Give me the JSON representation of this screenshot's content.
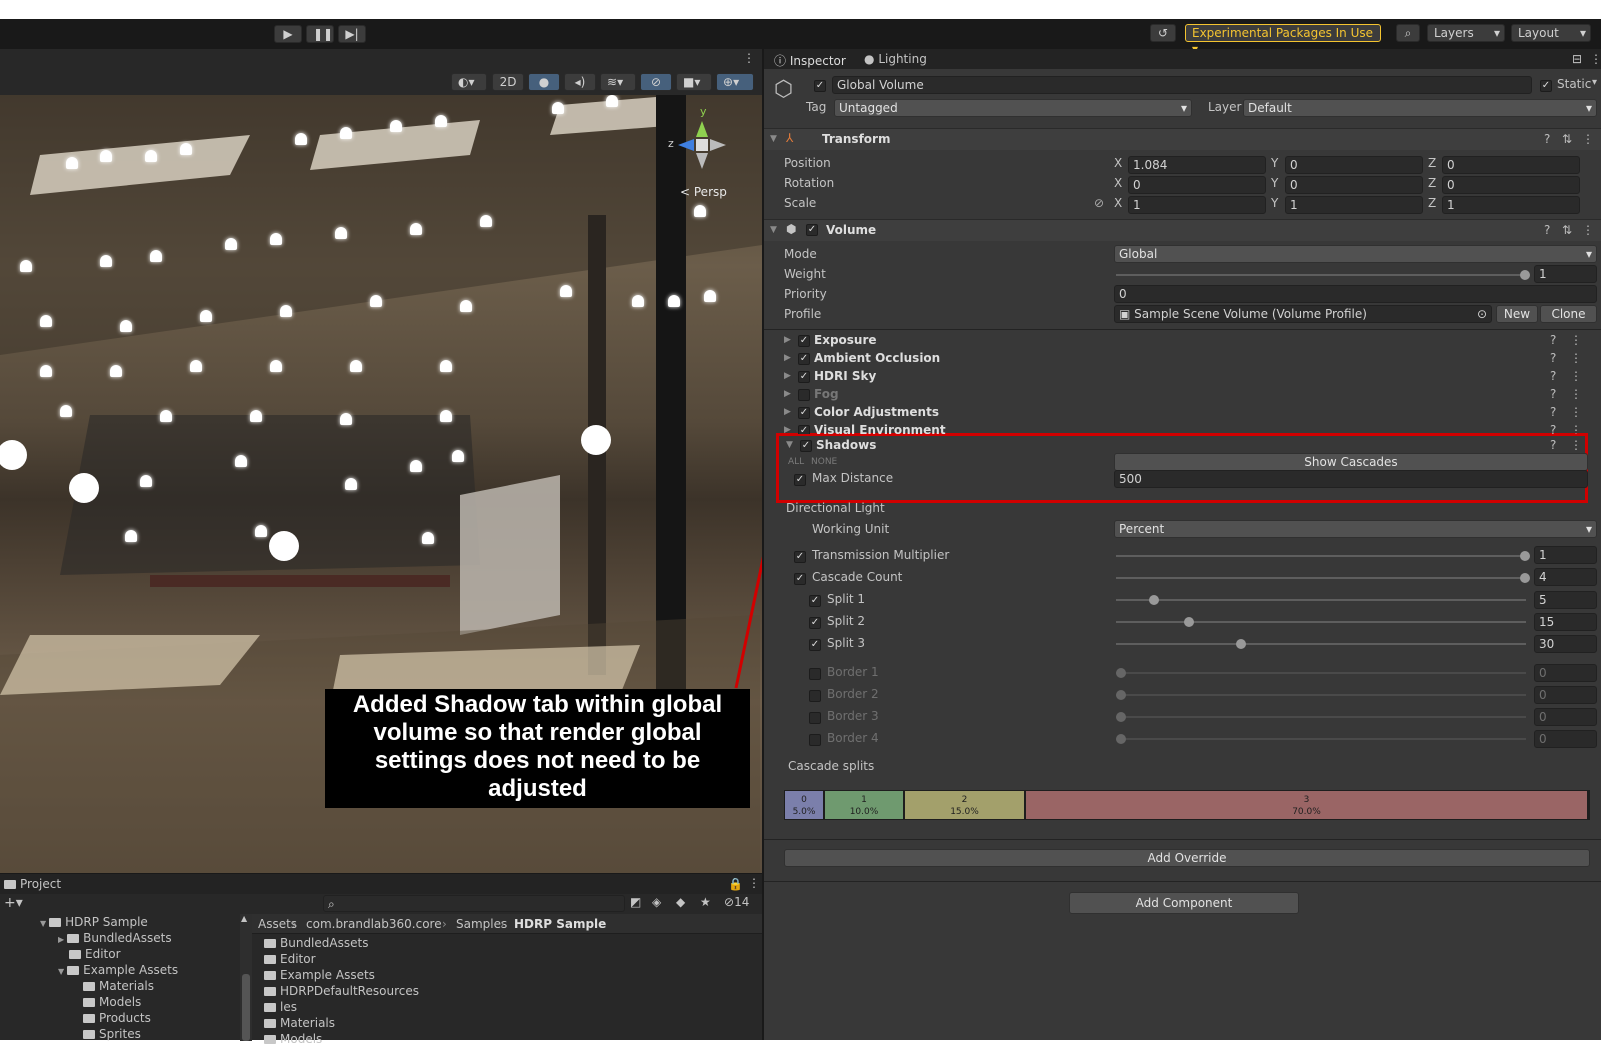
{
  "toolbar": {
    "experimental_label": "Experimental Packages In Use",
    "layers_label": "Layers",
    "layout_label": "Layout",
    "colors": {
      "experimental": "#f4c430"
    }
  },
  "scene": {
    "mode_2d": "2D",
    "persp_label": "Persp",
    "gizmo_y": "y",
    "gizmo_z": "z",
    "annotation": "Added Shadow tab within global volume so that render global settings does not need to be adjusted"
  },
  "project": {
    "tab_label": "Project",
    "hidden_count": "14",
    "tree": [
      {
        "label": "HDRP Sample",
        "depth": 0
      },
      {
        "label": "BundledAssets",
        "depth": 1
      },
      {
        "label": "Editor",
        "depth": 1
      },
      {
        "label": "Example Assets",
        "depth": 1
      },
      {
        "label": "Materials",
        "depth": 2
      },
      {
        "label": "Models",
        "depth": 2
      },
      {
        "label": "Products",
        "depth": 2
      },
      {
        "label": "Sprites",
        "depth": 2
      }
    ],
    "breadcrumb": [
      "Assets",
      "com.brandlab360.core",
      "Samples",
      "HDRP Sample"
    ],
    "files": [
      "BundledAssets",
      "Editor",
      "Example Assets",
      "HDRPDefaultResources",
      "les",
      "Materials",
      "Models"
    ]
  },
  "inspector": {
    "tab_inspector": "Inspector",
    "tab_lighting": "Lighting",
    "object_name": "Global Volume",
    "static_label": "Static",
    "tag_label": "Tag",
    "tag_value": "Untagged",
    "layer_label": "Layer",
    "layer_value": "Default",
    "transform": {
      "title": "Transform",
      "position_label": "Position",
      "position": [
        "1.084",
        "0",
        "0"
      ],
      "rotation_label": "Rotation",
      "rotation": [
        "0",
        "0",
        "0"
      ],
      "scale_label": "Scale",
      "scale": [
        "1",
        "1",
        "1"
      ],
      "axes": [
        "X",
        "Y",
        "Z"
      ]
    },
    "volume": {
      "title": "Volume",
      "mode_label": "Mode",
      "mode_value": "Global",
      "weight_label": "Weight",
      "weight_value": "1",
      "priority_label": "Priority",
      "priority_value": "0",
      "profile_label": "Profile",
      "profile_value": "Sample Scene Volume (Volume Profile)",
      "new_label": "New",
      "clone_label": "Clone"
    },
    "overrides": [
      {
        "label": "Exposure",
        "enabled": true
      },
      {
        "label": "Ambient Occlusion",
        "enabled": true
      },
      {
        "label": "HDRI Sky",
        "enabled": true
      },
      {
        "label": "Fog",
        "enabled": false
      },
      {
        "label": "Color Adjustments",
        "enabled": true
      },
      {
        "label": "Visual Environment",
        "enabled": true
      }
    ],
    "shadows": {
      "title": "Shadows",
      "all_label": "ALL",
      "none_label": "NONE",
      "show_cascades": "Show Cascades",
      "max_distance_label": "Max Distance",
      "max_distance_value": "500",
      "directional_light_label": "Directional Light",
      "working_unit_label": "Working Unit",
      "working_unit_value": "Percent",
      "transmission_label": "Transmission  Multiplier",
      "transmission_value": "1",
      "cascade_count_label": "Cascade Count",
      "cascade_count_value": "4",
      "splits": [
        {
          "label": "Split 1",
          "value": "5",
          "level": 0.05
        },
        {
          "label": "Split 2",
          "value": "15",
          "level": 0.15
        },
        {
          "label": "Split 3",
          "value": "30",
          "level": 0.3
        }
      ],
      "borders": [
        {
          "label": "Border 1",
          "value": "0"
        },
        {
          "label": "Border 2",
          "value": "0"
        },
        {
          "label": "Border 3",
          "value": "0"
        },
        {
          "label": "Border 4",
          "value": "0"
        }
      ],
      "cascade_splits_label": "Cascade splits",
      "cascades": [
        {
          "index": "0",
          "percent": "5.0%",
          "color": "#7b7fab"
        },
        {
          "index": "1",
          "percent": "10.0%",
          "color": "#6f9a6f"
        },
        {
          "index": "2",
          "percent": "15.0%",
          "color": "#a3a06b"
        },
        {
          "index": "3",
          "percent": "70.0%",
          "color": "#9a6565"
        }
      ]
    },
    "add_override": "Add Override",
    "add_component": "Add Component",
    "highlight_color": "#d10000"
  }
}
